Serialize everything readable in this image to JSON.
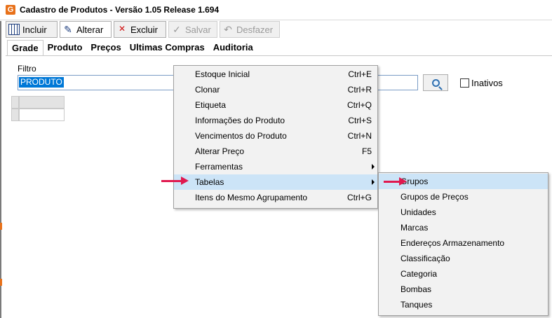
{
  "window": {
    "title": "Cadastro de Produtos - Versão 1.05 Release 1.694",
    "app_icon_letter": "G"
  },
  "toolbar": {
    "buttons": [
      {
        "label": "Incluir",
        "icon": "grid-add-icon",
        "enabled": true
      },
      {
        "label": "Alterar",
        "icon": "pencil-icon",
        "enabled": true
      },
      {
        "label": "Excluir",
        "icon": "grid-delete-icon",
        "enabled": true
      },
      {
        "label": "Salvar",
        "icon": "save-icon",
        "enabled": false
      },
      {
        "label": "Desfazer",
        "icon": "undo-icon",
        "enabled": false
      }
    ]
  },
  "tabs": [
    "Grade",
    "Produto",
    "Preços",
    "Ultimas Compras",
    "Auditoria"
  ],
  "filter": {
    "label": "Filtro",
    "value": "PRODUTO",
    "inactive_label": "Inativos",
    "inactive_checked": false
  },
  "context_menu": {
    "items": [
      {
        "label": "Estoque Inicial",
        "shortcut": "Ctrl+E"
      },
      {
        "label": "Clonar",
        "shortcut": "Ctrl+R"
      },
      {
        "label": "Etiqueta",
        "shortcut": "Ctrl+Q"
      },
      {
        "label": "Informações do Produto",
        "shortcut": "Ctrl+S"
      },
      {
        "label": "Vencimentos do Produto",
        "shortcut": "Ctrl+N"
      },
      {
        "label": "Alterar Preço",
        "shortcut": "F5"
      },
      {
        "label": "Ferramentas",
        "shortcut": "",
        "submenu": true
      },
      {
        "label": "Tabelas",
        "shortcut": "",
        "submenu": true,
        "highlighted": true
      },
      {
        "label": "Itens do Mesmo  Agrupamento",
        "shortcut": "Ctrl+G"
      }
    ]
  },
  "submenu": {
    "items": [
      {
        "label": "Grupos",
        "highlighted": true
      },
      {
        "label": "Grupos de Preços"
      },
      {
        "label": "Unidades"
      },
      {
        "label": "Marcas"
      },
      {
        "label": "Endereços Armazenamento"
      },
      {
        "label": "Classificação"
      },
      {
        "label": "Categoria"
      },
      {
        "label": "Bombas"
      },
      {
        "label": "Tanques"
      }
    ]
  },
  "colors": {
    "highlight": "#cce4f7",
    "selection": "#0078d7",
    "annotation_arrow": "#e0194f",
    "app_icon": "#e8711a"
  }
}
